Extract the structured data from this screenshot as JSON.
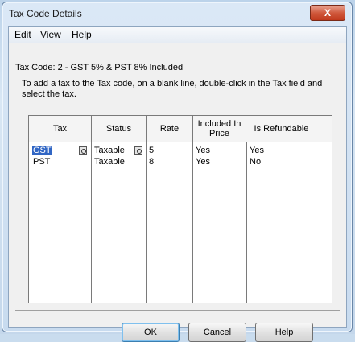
{
  "window": {
    "title": "Tax Code Details",
    "close_label": "X"
  },
  "menu": [
    {
      "label": "Edit"
    },
    {
      "label": "View"
    },
    {
      "label": "Help"
    }
  ],
  "tax_code_line": "Tax Code: 2 - GST 5% & PST 8% Included",
  "instruction": "To add a tax to the Tax code, on a blank line, double-click in the Tax field and select the tax.",
  "table": {
    "columns": [
      "Tax",
      "Status",
      "Rate",
      "Included In Price",
      "Is Refundable"
    ],
    "rows": [
      {
        "tax": "GST",
        "status": "Taxable",
        "rate": "5",
        "included": "Yes",
        "refundable": "Yes"
      },
      {
        "tax": "PST",
        "status": "Taxable",
        "rate": "8",
        "included": "Yes",
        "refundable": "No"
      }
    ]
  },
  "buttons": {
    "ok": "OK",
    "cancel": "Cancel",
    "help": "Help"
  },
  "colors": {
    "selection": "#3166c4",
    "close_button": "#c0391c"
  }
}
